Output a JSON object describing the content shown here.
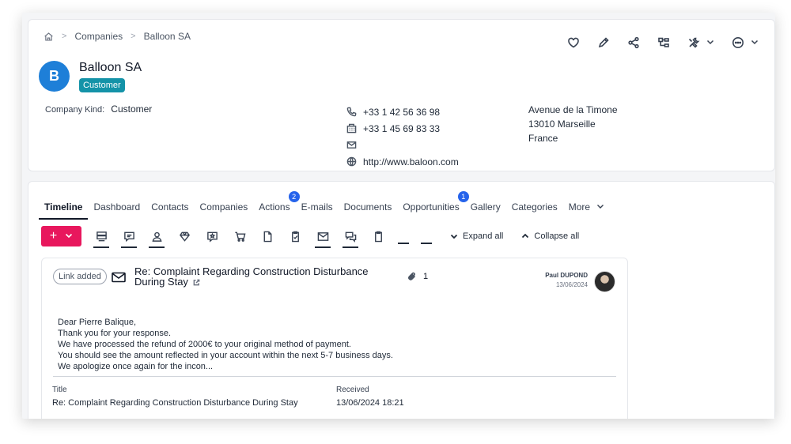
{
  "breadcrumb": {
    "items": [
      "Companies",
      "Balloon SA"
    ]
  },
  "company": {
    "avatar_letter": "B",
    "name": "Balloon SA",
    "badge": "Customer",
    "kind_label": "Company Kind:",
    "kind_value": "Customer",
    "phone": "+33 1 42 56 36 98",
    "fax": "+33 1 45 69 83 33",
    "email": "",
    "website": "http://www.baloon.com",
    "address": [
      "Avenue de la Timone",
      "13010 Marseille",
      "France"
    ]
  },
  "tabs": [
    {
      "label": "Timeline",
      "active": true,
      "count": ""
    },
    {
      "label": "Dashboard",
      "active": false,
      "count": ""
    },
    {
      "label": "Contacts",
      "active": false,
      "count": ""
    },
    {
      "label": "Companies",
      "active": false,
      "count": ""
    },
    {
      "label": "Actions",
      "active": false,
      "count": "2"
    },
    {
      "label": "E-mails",
      "active": false,
      "count": ""
    },
    {
      "label": "Documents",
      "active": false,
      "count": ""
    },
    {
      "label": "Opportunities",
      "active": false,
      "count": "1"
    },
    {
      "label": "Gallery",
      "active": false,
      "count": ""
    },
    {
      "label": "Categories",
      "active": false,
      "count": ""
    }
  ],
  "tabs_more": "More",
  "toolbar": {
    "add": "+",
    "expand_all": "Expand all",
    "collapse_all": "Collapse all"
  },
  "email": {
    "link_badge": "Link added",
    "subject": "Re: Complaint Regarding Construction Disturbance During Stay",
    "attachments": "1",
    "sender_name": "Paul DUPOND",
    "sender_date": "13/06/2024",
    "body": [
      "Dear Pierre Balique,",
      "Thank you for your response.",
      "We have processed the refund of 2000€ to your original method of payment.",
      "You should see the amount reflected in your account within the next 5-7 business days.",
      "We apologize once again for the incon..."
    ],
    "title_label": "Title",
    "title_value": "Re: Complaint Regarding Construction Disturbance During Stay",
    "received_label": "Received",
    "received_value": "13/06/2024 18:21"
  },
  "colors": {
    "primary": "#1e7fd8",
    "badge": "#1493a8",
    "add_button": "#e8175d",
    "count_badge": "#2563eb"
  }
}
